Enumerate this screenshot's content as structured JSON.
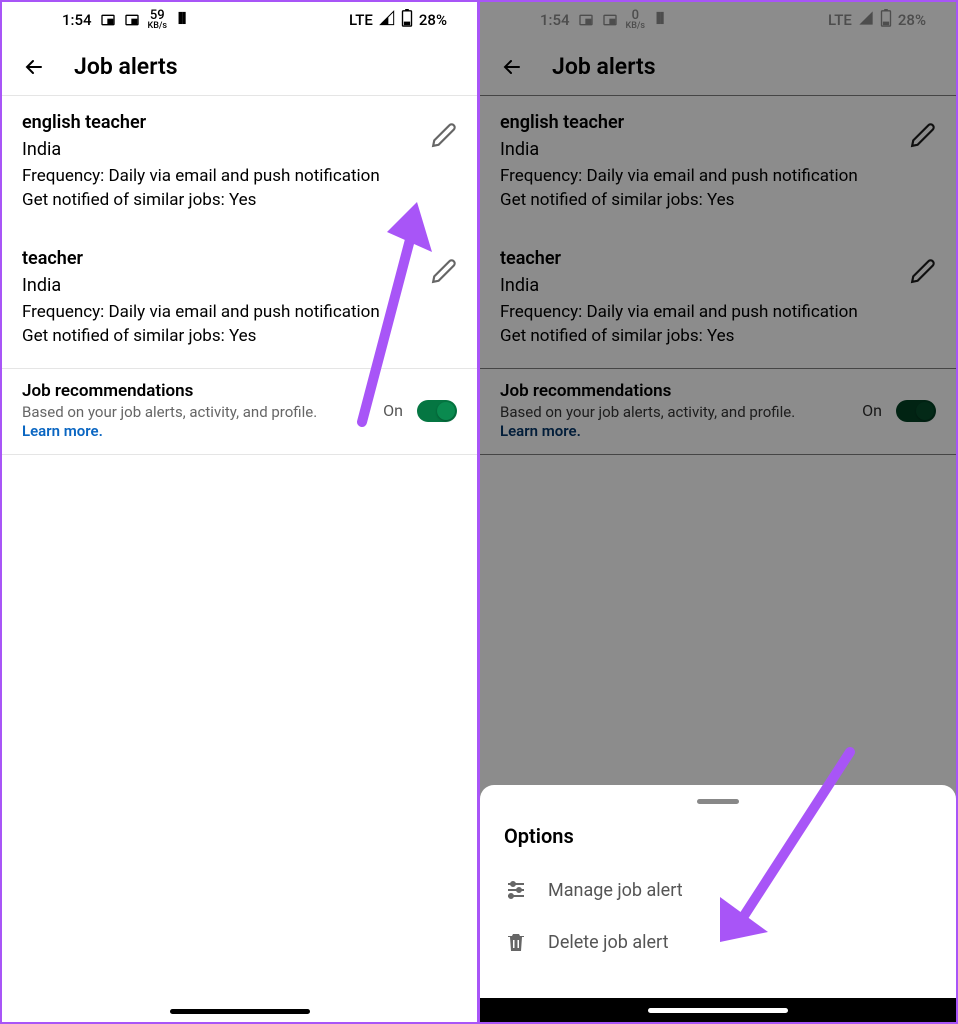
{
  "status": {
    "time": "1:54",
    "kbps_left": "59",
    "kbps_right": "0",
    "kbps_label": "KB/s",
    "network": "LTE",
    "battery": "28%"
  },
  "header": {
    "title": "Job alerts"
  },
  "alerts": [
    {
      "title": "english teacher",
      "location": "India",
      "frequency": "Frequency: Daily via email and push notification",
      "similar": "Get notified of similar jobs: Yes"
    },
    {
      "title": "teacher",
      "location": "India",
      "frequency": "Frequency: Daily via email and push notification",
      "similar": "Get notified of similar jobs: Yes"
    }
  ],
  "recommendations": {
    "title": "Job recommendations",
    "subtitle": "Based on your job alerts, activity, and profile.",
    "learn_more": "Learn more.",
    "on_label": "On"
  },
  "sheet": {
    "title": "Options",
    "manage": "Manage job alert",
    "delete": "Delete job alert"
  }
}
